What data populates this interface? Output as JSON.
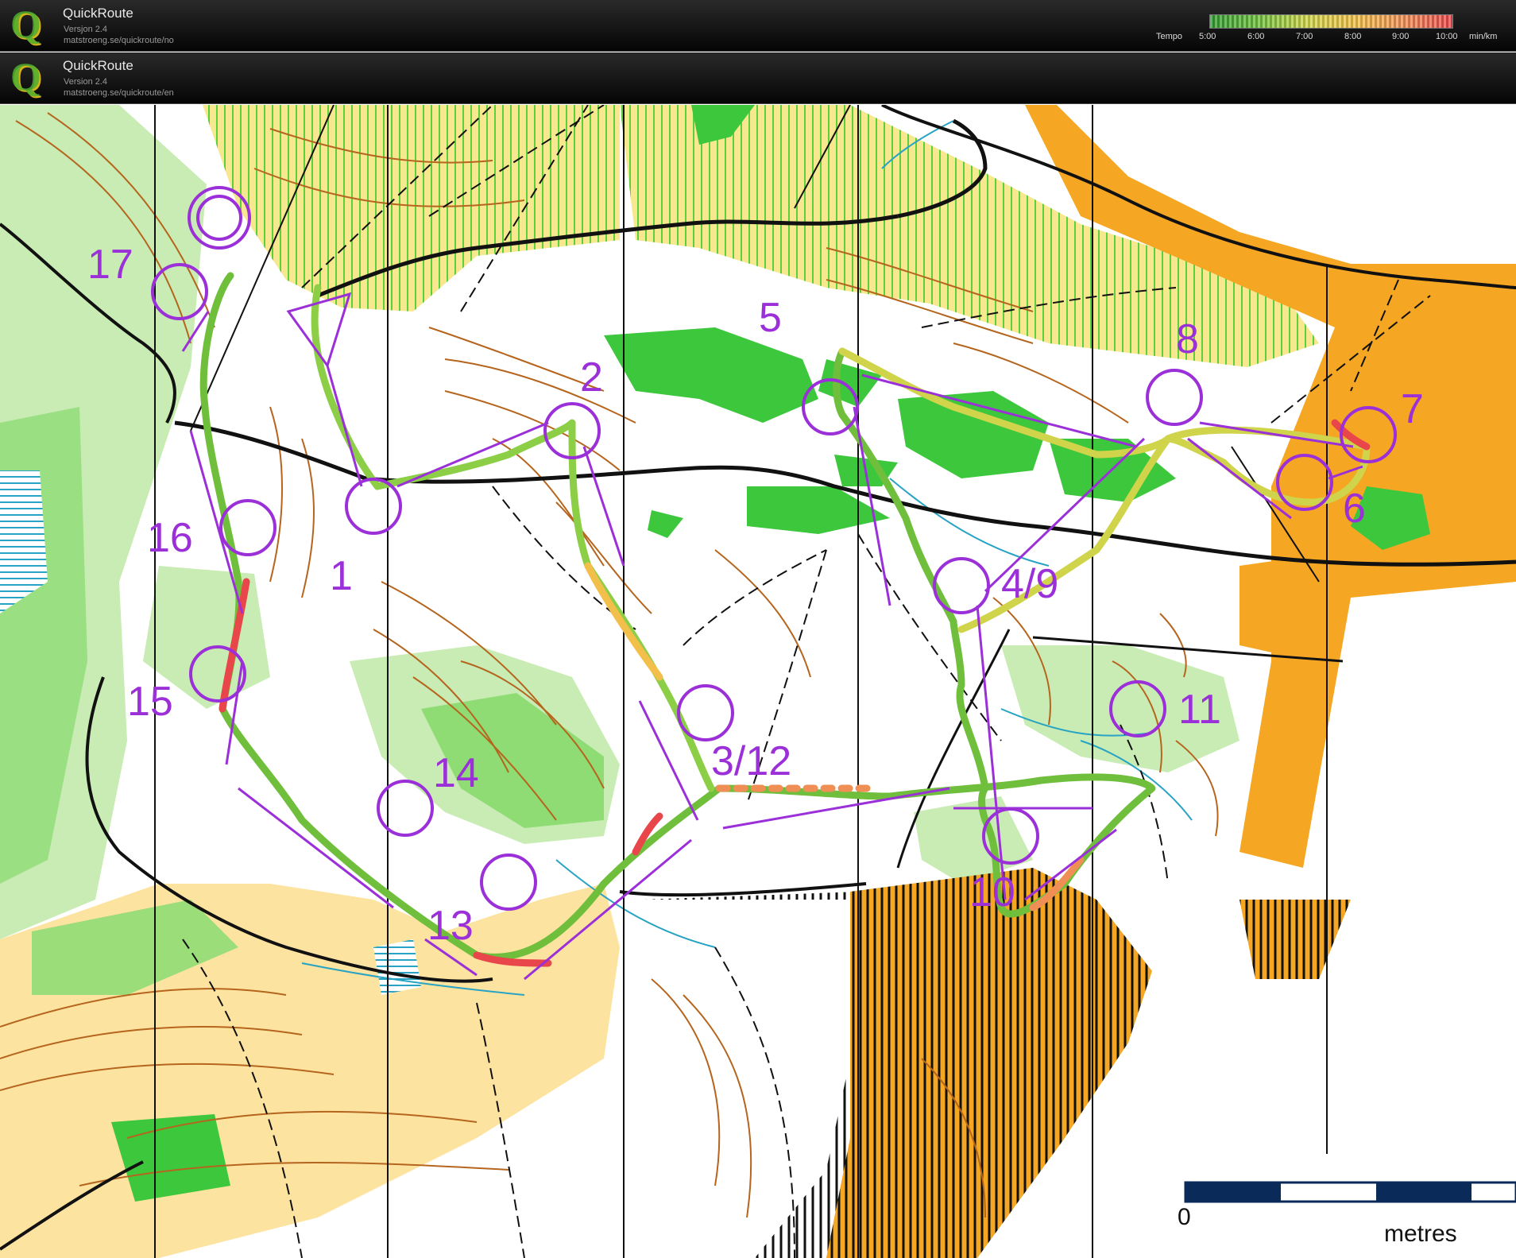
{
  "headers": [
    {
      "title": "QuickRoute",
      "version": "Versjon 2.4",
      "url": "matstroeng.se/quickroute/no"
    },
    {
      "title": "QuickRoute",
      "version": "Version 2.4",
      "url": "matstroeng.se/quickroute/en"
    }
  ],
  "logo_letter": "Q",
  "tempo_scale": {
    "label": "Tempo",
    "ticks": [
      "5:00",
      "6:00",
      "7:00",
      "8:00",
      "9:00",
      "10:00"
    ],
    "unit": "min/km",
    "colors": [
      "#2f9a2f",
      "#6fbf3c",
      "#cfd44a",
      "#f2c04a",
      "#ef8f55",
      "#e8464a"
    ]
  },
  "course": {
    "color": "#9b30d9",
    "controls": [
      {
        "label": "1"
      },
      {
        "label": "2"
      },
      {
        "label": "3/12"
      },
      {
        "label": "4/9"
      },
      {
        "label": "5"
      },
      {
        "label": "6"
      },
      {
        "label": "7"
      },
      {
        "label": "8"
      },
      {
        "label": "10"
      },
      {
        "label": "11"
      },
      {
        "label": "13"
      },
      {
        "label": "14"
      },
      {
        "label": "15"
      },
      {
        "label": "16"
      },
      {
        "label": "17"
      }
    ]
  },
  "scale_bar": {
    "zero": "0",
    "unit": "metres"
  },
  "map_colors": {
    "forest": "#ffffff",
    "open": "#f7e78f",
    "rough_open": "#fde3a0",
    "green_light": "#c8ecb4",
    "green_medium": "#8fdc74",
    "green_dark": "#3cc73c",
    "contour": "#b5651d",
    "water": "#29a3c4",
    "orange": "#f5a623",
    "road": "#111111",
    "route_fast": "#6fbf3c",
    "route_slow": "#e8464a"
  }
}
